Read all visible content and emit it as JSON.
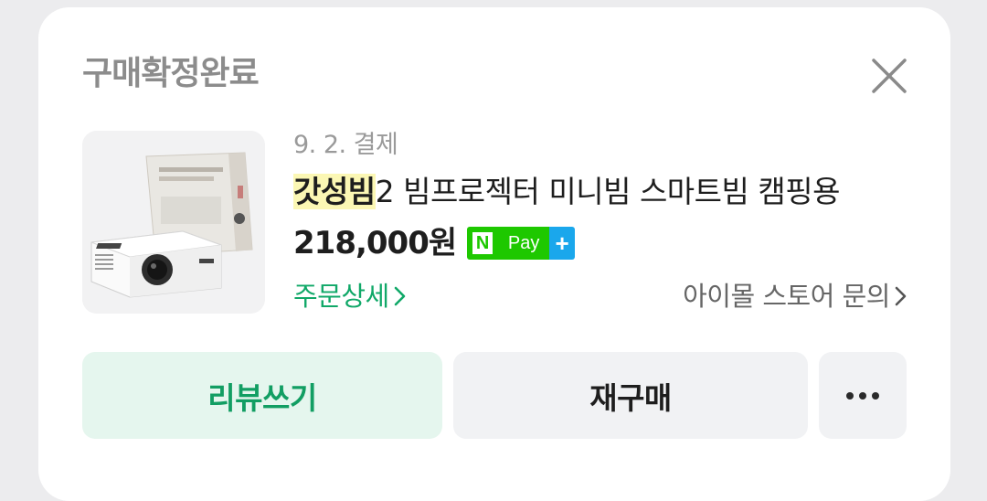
{
  "card": {
    "status_title": "구매확정완료",
    "close_icon": "close-icon"
  },
  "order": {
    "pay_date": "9. 2. 결제",
    "product_name_highlight": "갓성빔",
    "product_name_rest": "2 빔프로젝터 미니빔 스마트빔 캠핑용",
    "price": "218,000원",
    "npay_badge": {
      "n": "N",
      "pay": "Pay",
      "plus": "+"
    },
    "thumbnail_icon": "projector-product-image"
  },
  "links": {
    "order_detail": "주문상세",
    "store_inquiry": "아이몰 스토어 문의"
  },
  "actions": {
    "review_label": "리뷰쓰기",
    "rebuy_label": "재구매",
    "more_icon": "more-icon"
  },
  "colors": {
    "accent_green": "#10a868",
    "review_bg": "#e5f6ee",
    "highlight_yellow": "#fbf7b4",
    "npay_green": "#1ec800",
    "npay_blue": "#1aa7ec"
  }
}
